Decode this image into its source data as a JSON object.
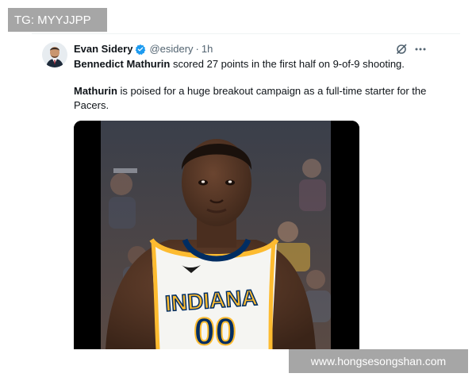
{
  "overlay": {
    "tg_label": "TG: MYYJJPP",
    "site_watermark": "www.hongsesongshan.com"
  },
  "tweet": {
    "author_name": "Evan Sidery",
    "handle": "@esidery",
    "separator": "·",
    "time": "1h",
    "verified": true,
    "line1_bold": "Bennedict Mathurin",
    "line1_rest": " scored 27 points in the first half on 9-of-9 shooting.",
    "line2_bold": "Mathurin",
    "line2_rest": " is poised for a huge breakout campaign as a full-time starter for the Pacers.",
    "media": {
      "jersey_text": "INDIANA",
      "jersey_number": "00"
    }
  },
  "colors": {
    "accent_blue": "#1d9bf0",
    "text_primary": "#0f1419",
    "text_secondary": "#536471",
    "jersey_gold": "#fdbb30",
    "jersey_navy": "#002d62"
  },
  "icons": {
    "verified": "verified-badge-icon",
    "grok": "grok-icon",
    "more": "more-options-icon"
  }
}
